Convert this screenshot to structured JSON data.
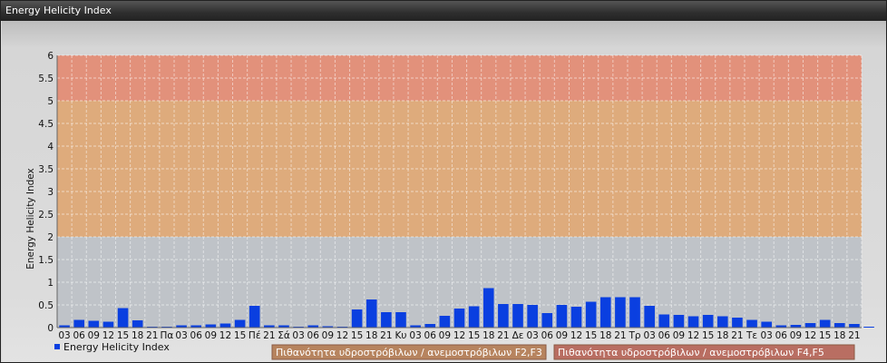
{
  "window": {
    "title": "Energy Helicity Index"
  },
  "chart_data": {
    "type": "bar",
    "title": "",
    "ylabel": "Energy Helicity Index",
    "ylim": [
      0,
      6
    ],
    "yticks": [
      "0",
      "0.5",
      "1",
      "1.5",
      "2",
      "2.5",
      "3",
      "3.5",
      "4",
      "4.5",
      "5",
      "5.5",
      "6"
    ],
    "grid": true,
    "legend_position": "bottom-left",
    "categories": [
      "03",
      "06",
      "09",
      "12",
      "15",
      "18",
      "21",
      "Πα",
      "03",
      "06",
      "09",
      "12",
      "15",
      "Πέ",
      "21",
      "Σά",
      "03",
      "06",
      "09",
      "12",
      "15",
      "18",
      "21",
      "Κυ",
      "03",
      "06",
      "09",
      "12",
      "15",
      "18",
      "21",
      "Δε",
      "03",
      "06",
      "09",
      "12",
      "15",
      "18",
      "21",
      "Τρ",
      "03",
      "06",
      "09",
      "12",
      "15",
      "18",
      "21",
      "Τε",
      "03",
      "06",
      "09",
      "12",
      "15",
      "18",
      "21"
    ],
    "series": [
      {
        "name": "Energy Helicity Index",
        "color": "#0a3fe0",
        "values": [
          0.05,
          0.17,
          0.15,
          0.13,
          0.43,
          0.16,
          0.02,
          0.02,
          0.05,
          0.05,
          0.07,
          0.09,
          0.17,
          0.48,
          0.05,
          0.05,
          0.02,
          0.05,
          0.03,
          0.02,
          0.4,
          0.62,
          0.34,
          0.34,
          0.05,
          0.08,
          0.26,
          0.42,
          0.47,
          0.87,
          0.52,
          0.52,
          0.5,
          0.32,
          0.5,
          0.46,
          0.57,
          0.67,
          0.67,
          0.67,
          0.48,
          0.29,
          0.28,
          0.25,
          0.28,
          0.25,
          0.22,
          0.17,
          0.13,
          0.05,
          0.06,
          0.1,
          0.17,
          0.1,
          0.08,
          0.02
        ]
      }
    ],
    "bands": [
      {
        "from": 0,
        "to": 2,
        "color": "#bfc3c8",
        "label": ""
      },
      {
        "from": 2,
        "to": 5,
        "color": "#deab7c",
        "label": "Πιθανότητα υδροστρόβιλων / ανεμοστρόβιλων F2,F3"
      },
      {
        "from": 5,
        "to": 6,
        "color": "#e2917b",
        "label": "Πιθανότητα υδροστρόβιλων / ανεμοστρόβιλων F4,F5"
      }
    ],
    "band_label_colors": [
      "#b7845f",
      "#b96e62"
    ]
  }
}
